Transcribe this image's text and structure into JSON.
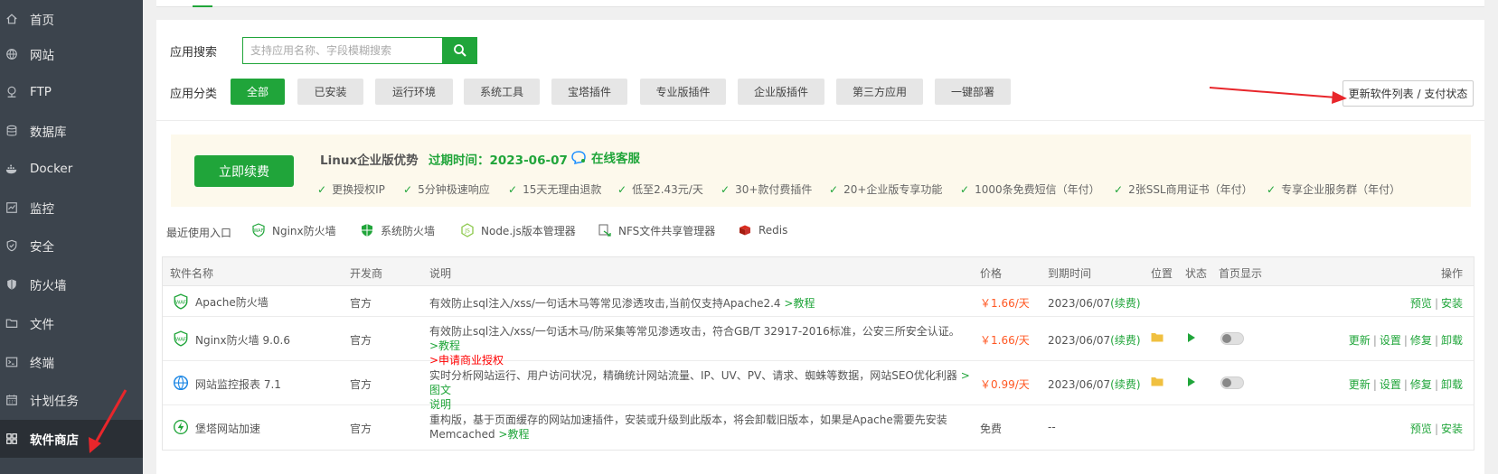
{
  "sidebar": {
    "items": [
      {
        "label": "首页",
        "icon": "home-icon"
      },
      {
        "label": "网站",
        "icon": "globe-icon"
      },
      {
        "label": "FTP",
        "icon": "ftp-icon"
      },
      {
        "label": "数据库",
        "icon": "database-icon"
      },
      {
        "label": "Docker",
        "icon": "docker-icon"
      },
      {
        "label": "监控",
        "icon": "monitor-icon"
      },
      {
        "label": "安全",
        "icon": "shield-check-icon"
      },
      {
        "label": "防火墙",
        "icon": "firewall-icon"
      },
      {
        "label": "文件",
        "icon": "folder-icon"
      },
      {
        "label": "终端",
        "icon": "terminal-icon"
      },
      {
        "label": "计划任务",
        "icon": "calendar-icon"
      },
      {
        "label": "软件商店",
        "icon": "grid-icon"
      }
    ],
    "active_index": 11
  },
  "search": {
    "label": "应用搜索",
    "placeholder": "支持应用名称、字段模糊搜索",
    "value": ""
  },
  "category": {
    "label": "应用分类",
    "items": [
      "全部",
      "已安装",
      "运行环境",
      "系统工具",
      "宝塔插件",
      "专业版插件",
      "企业版插件",
      "第三方应用",
      "一键部署"
    ],
    "active_index": 0
  },
  "update_button": "更新软件列表 / 支付状态",
  "banner": {
    "renew_button": "立即续费",
    "title": "Linux企业版优势",
    "expire": "过期时间：2023-06-07",
    "service": "在线客服",
    "features": [
      "更换授权IP",
      "5分钟极速响应",
      "15天无理由退款",
      "低至2.43元/天",
      "30+款付费插件",
      "20+企业版专享功能",
      "1000条免费短信（年付）",
      "2张SSL商用证书（年付）",
      "专享企业服务群（年付）"
    ]
  },
  "recent": {
    "label": "最近使用入口",
    "items": [
      {
        "label": "Nginx防火墙",
        "icon": "waf-icon"
      },
      {
        "label": "系统防火墙",
        "icon": "shield-icon"
      },
      {
        "label": "Node.js版本管理器",
        "icon": "nodejs-icon"
      },
      {
        "label": "NFS文件共享管理器",
        "icon": "nfs-icon"
      },
      {
        "label": "Redis",
        "icon": "redis-icon"
      }
    ]
  },
  "table": {
    "headers": {
      "name": "软件名称",
      "dev": "开发商",
      "desc": "说明",
      "price": "价格",
      "expire": "到期时间",
      "location": "位置",
      "status": "状态",
      "homepage": "首页显示",
      "ops": "操作"
    },
    "rows": [
      {
        "icon": "waf-icon",
        "name": "Apache防火墙",
        "dev": "官方",
        "desc": "有效防止sql注入/xss/一句话木马等常见渗透攻击,当前仅支持Apache2.4",
        "desc_link": ">教程",
        "price": "￥1.66/天",
        "expire": "2023/06/07",
        "renew": "(续费)",
        "ops": [
          "预览",
          "安装"
        ]
      },
      {
        "icon": "waf-icon",
        "name": "Nginx防火墙 9.0.6",
        "dev": "官方",
        "desc": "有效防止sql注入/xss/一句话木马/防采集等常见渗透攻击，符合GB/T 32917-2016标准，公安三所安全认证。",
        "desc_link": ">教程",
        "desc_link2": ">申请商业授权",
        "price": "￥1.66/天",
        "expire": "2023/06/07",
        "renew": "(续费)",
        "ops": [
          "更新",
          "设置",
          "修复",
          "卸载"
        ]
      },
      {
        "icon": "monitor-globe-icon",
        "name": "网站监控报表 7.1",
        "dev": "官方",
        "desc": "实时分析网站运行、用户访问状况，精确统计网站流量、IP、UV、PV、请求、蜘蛛等数据，网站SEO优化利器",
        "desc_link": ">图文",
        "desc_link_b": "说明",
        "price": "￥0.99/天",
        "expire": "2023/06/07",
        "renew": "(续费)",
        "ops": [
          "更新",
          "设置",
          "修复",
          "卸载"
        ]
      },
      {
        "icon": "lightning-icon",
        "name": "堡塔网站加速",
        "dev": "官方",
        "desc": "重构版，基于页面缓存的网站加速插件，安装或升级到此版本，将会卸载旧版本，如果是Apache需要先安装",
        "desc_b": "Memcached",
        "desc_link": ">教程",
        "price": "免费",
        "expire": "--",
        "ops": [
          "预览",
          "安装"
        ]
      }
    ]
  },
  "colors": {
    "accent": "#20a53a",
    "sidebar_bg": "#3c444d",
    "price": "#ff5722",
    "annotation_arrow": "#e8262b"
  }
}
